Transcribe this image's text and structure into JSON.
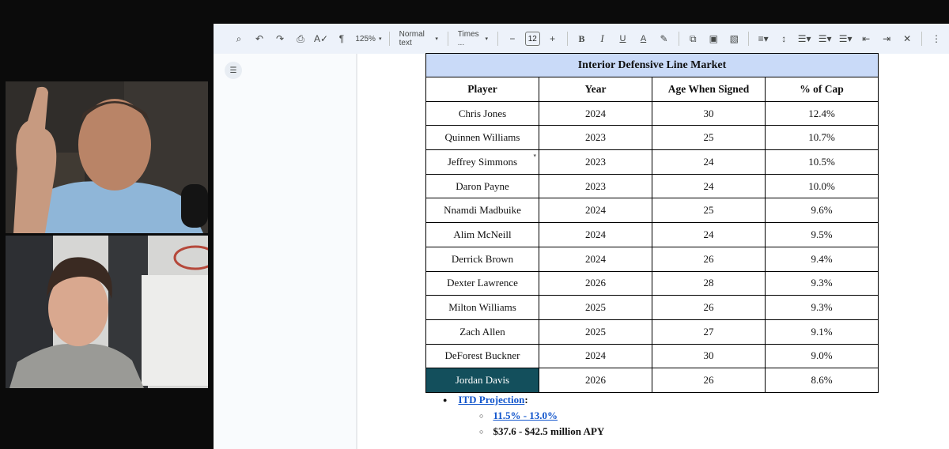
{
  "toolbar": {
    "zoom": "125%",
    "style": "Normal text",
    "font": "Times ...",
    "font_size": "12"
  },
  "table": {
    "title": "Interior Defensive Line Market",
    "headers": [
      "Player",
      "Year",
      "Age When Signed",
      "% of Cap"
    ],
    "rows": [
      [
        "Chris Jones",
        "2024",
        "30",
        "12.4%"
      ],
      [
        "Quinnen Williams",
        "2023",
        "25",
        "10.7%"
      ],
      [
        "Jeffrey Simmons",
        "2023",
        "24",
        "10.5%"
      ],
      [
        "Daron Payne",
        "2023",
        "24",
        "10.0%"
      ],
      [
        "Nnamdi Madbuike",
        "2024",
        "25",
        "9.6%"
      ],
      [
        "Alim McNeill",
        "2024",
        "24",
        "9.5%"
      ],
      [
        "Derrick Brown",
        "2024",
        "26",
        "9.4%"
      ],
      [
        "Dexter Lawrence",
        "2026",
        "28",
        "9.3%"
      ],
      [
        "Milton Williams",
        "2025",
        "26",
        "9.3%"
      ],
      [
        "Zach Allen",
        "2025",
        "27",
        "9.1%"
      ],
      [
        "DeForest Buckner",
        "2024",
        "30",
        "9.0%"
      ],
      [
        "Jordan Davis",
        "2026",
        "26",
        "8.6%"
      ]
    ],
    "highlight_color": "#134f5c",
    "title_bg": "#c9daf8"
  },
  "notes": {
    "projection_label": "ITD Projection",
    "projection_colon": ":",
    "range_pct": "11.5% - 13.0%",
    "range_apy": "$37.6 - $42.5 million APY"
  }
}
